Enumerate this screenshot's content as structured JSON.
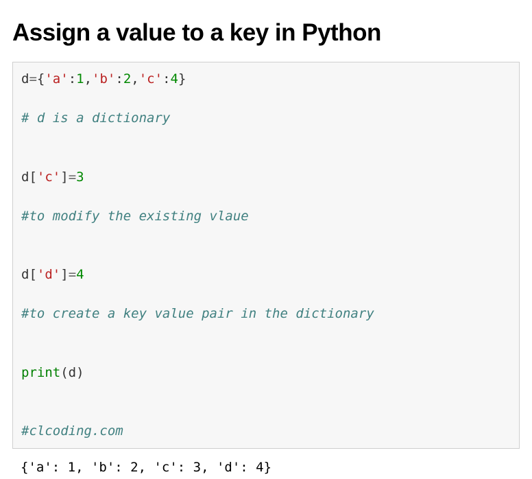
{
  "heading": "Assign a value to a key in Python",
  "code": {
    "l1": {
      "t1": "d",
      "t2": "=",
      "t3": "{",
      "t4": "'a'",
      "t5": ":",
      "t6": "1",
      "t7": ",",
      "t8": "'b'",
      "t9": ":",
      "t10": "2",
      "t11": ",",
      "t12": "'c'",
      "t13": ":",
      "t14": "4",
      "t15": "}"
    },
    "l2": "# d is a dictionary",
    "l3": {
      "t1": "d",
      "t2": "[",
      "t3": "'c'",
      "t4": "]",
      "t5": "=",
      "t6": "3"
    },
    "l4": "#to modify the existing vlaue",
    "l5": {
      "t1": "d",
      "t2": "[",
      "t3": "'d'",
      "t4": "]",
      "t5": "=",
      "t6": "4"
    },
    "l6": "#to create a key value pair in the dictionary",
    "l7": {
      "t1": "print",
      "t2": "(",
      "t3": "d",
      "t4": ")"
    },
    "l8": "#clcoding.com"
  },
  "output": "{'a': 1, 'b': 2, 'c': 3, 'd': 4}"
}
